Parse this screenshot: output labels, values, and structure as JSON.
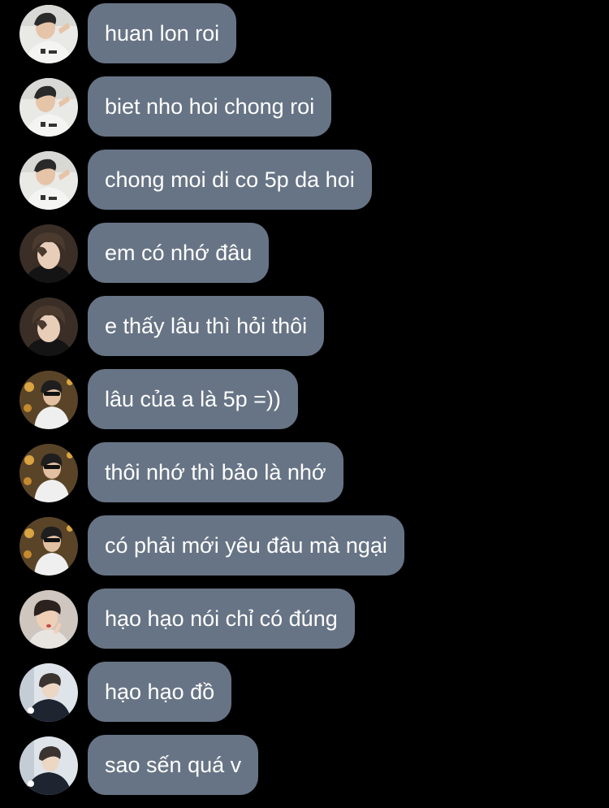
{
  "colors": {
    "background": "#000000",
    "bubble": "#677485",
    "bubble_text": "#ffffff"
  },
  "messages": [
    {
      "text": "huan lon roi",
      "avatar": "avatar-user-a"
    },
    {
      "text": "biet nho hoi chong roi",
      "avatar": "avatar-user-a"
    },
    {
      "text": "chong moi di co 5p da hoi",
      "avatar": "avatar-user-a"
    },
    {
      "text": "em có nhớ đâu",
      "avatar": "avatar-user-b"
    },
    {
      "text": "e thấy lâu thì hỏi thôi",
      "avatar": "avatar-user-b"
    },
    {
      "text": "lâu của a là 5p =))",
      "avatar": "avatar-user-c"
    },
    {
      "text": "thôi nhớ thì bảo là nhớ",
      "avatar": "avatar-user-c"
    },
    {
      "text": "có phải mới yêu đâu mà ngại",
      "avatar": "avatar-user-c"
    },
    {
      "text": "hạo hạo nói chỉ có đúng",
      "avatar": "avatar-user-d"
    },
    {
      "text": "hạo hạo đồ",
      "avatar": "avatar-user-e"
    },
    {
      "text": "sao sến quá v",
      "avatar": "avatar-user-e"
    }
  ]
}
